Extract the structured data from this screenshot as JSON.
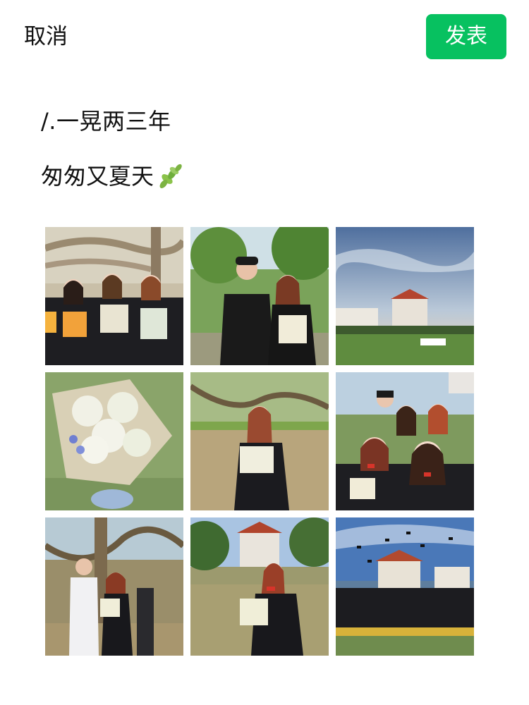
{
  "header": {
    "cancel_label": "取消",
    "publish_label": "发表"
  },
  "post": {
    "line1": "/.一晃两三年",
    "line2": "匆匆又夏天",
    "emoji": "herb-leaf-emoji"
  },
  "photos": [
    {
      "label": "graduates-holding-flowers-under-banyan"
    },
    {
      "label": "couple-peace-sign-under-trees"
    },
    {
      "label": "campus-building-sunset-sky"
    },
    {
      "label": "white-rose-bouquet-closeup"
    },
    {
      "label": "graduate-with-bouquet-under-tree"
    },
    {
      "label": "group-selfie-graduates"
    },
    {
      "label": "couple-under-banyan-tree"
    },
    {
      "label": "graduate-posing-campus-building"
    },
    {
      "label": "caps-thrown-in-air-group"
    }
  ],
  "colors": {
    "accent": "#07c160",
    "text": "#111111",
    "background": "#ffffff"
  }
}
